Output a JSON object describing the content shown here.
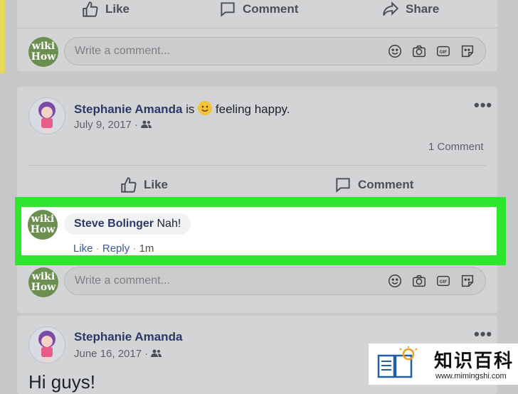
{
  "top_post": {
    "actions": {
      "like": "Like",
      "comment": "Comment",
      "share": "Share"
    },
    "comment_placeholder": "Write a comment..."
  },
  "post1": {
    "author": "Stephanie Amanda",
    "is_text": "is",
    "feeling": "feeling happy.",
    "date": "July 9, 2017",
    "comment_count": "1 Comment",
    "actions": {
      "like": "Like",
      "comment": "Comment"
    },
    "comment": {
      "author": "Steve Bolinger",
      "text": "Nah!",
      "like": "Like",
      "reply": "Reply",
      "time": "1m",
      "sep": "·"
    },
    "comment_placeholder": "Write a comment..."
  },
  "post2": {
    "author": "Stephanie Amanda",
    "date": "June 16, 2017",
    "body": "Hi guys!"
  },
  "avatar_text": {
    "line1": "wiki",
    "line2": "How"
  },
  "watermark": {
    "title": "知识百科",
    "url": "www.mimingshi.com"
  },
  "colors": {
    "highlight": "#2ee62e",
    "name": "#2a3a66"
  }
}
